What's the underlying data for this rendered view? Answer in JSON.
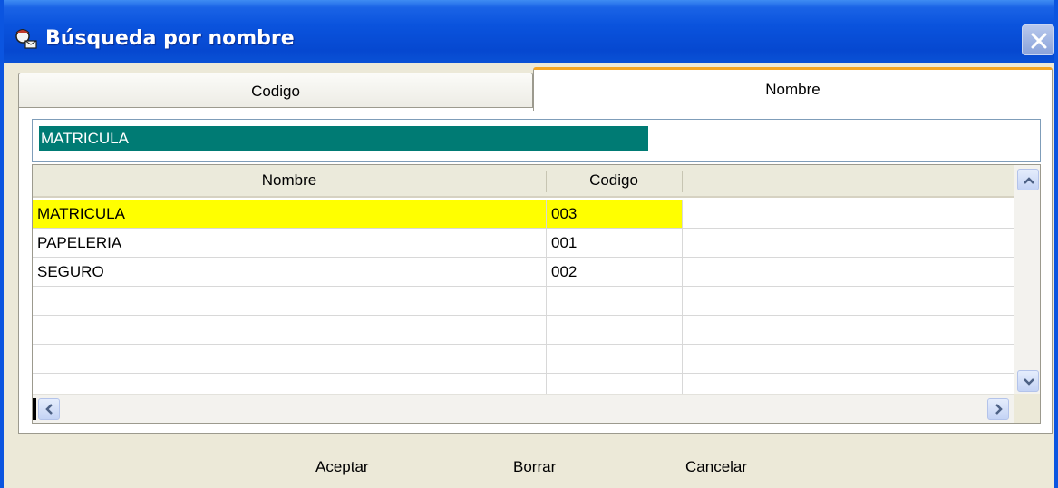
{
  "window": {
    "title": "Búsqueda por nombre",
    "colors": {
      "titlebar": "#0a53dd",
      "selection_fill": "#ffff00",
      "search_highlight": "#007b74",
      "active_tab_accent": "#f5a623"
    }
  },
  "tabs": [
    {
      "label": "Codigo",
      "active": false
    },
    {
      "label": "Nombre",
      "active": true
    }
  ],
  "search": {
    "value": "MATRICULA"
  },
  "grid": {
    "columns": [
      "Nombre",
      "Codigo"
    ],
    "rows": [
      {
        "nombre": "MATRICULA",
        "codigo": "003",
        "selected": true
      },
      {
        "nombre": "PAPELERIA",
        "codigo": "001",
        "selected": false
      },
      {
        "nombre": "SEGURO",
        "codigo": "002",
        "selected": false
      },
      {
        "nombre": "",
        "codigo": "",
        "selected": false
      },
      {
        "nombre": "",
        "codigo": "",
        "selected": false
      },
      {
        "nombre": "",
        "codigo": "",
        "selected": false
      },
      {
        "nombre": "",
        "codigo": "",
        "selected": false
      }
    ]
  },
  "buttons": {
    "aceptar": {
      "mnemonic": "A",
      "rest": "ceptar"
    },
    "borrar": {
      "mnemonic": "B",
      "rest": "orrar"
    },
    "cancelar": {
      "mnemonic": "C",
      "rest": "ancelar"
    }
  }
}
